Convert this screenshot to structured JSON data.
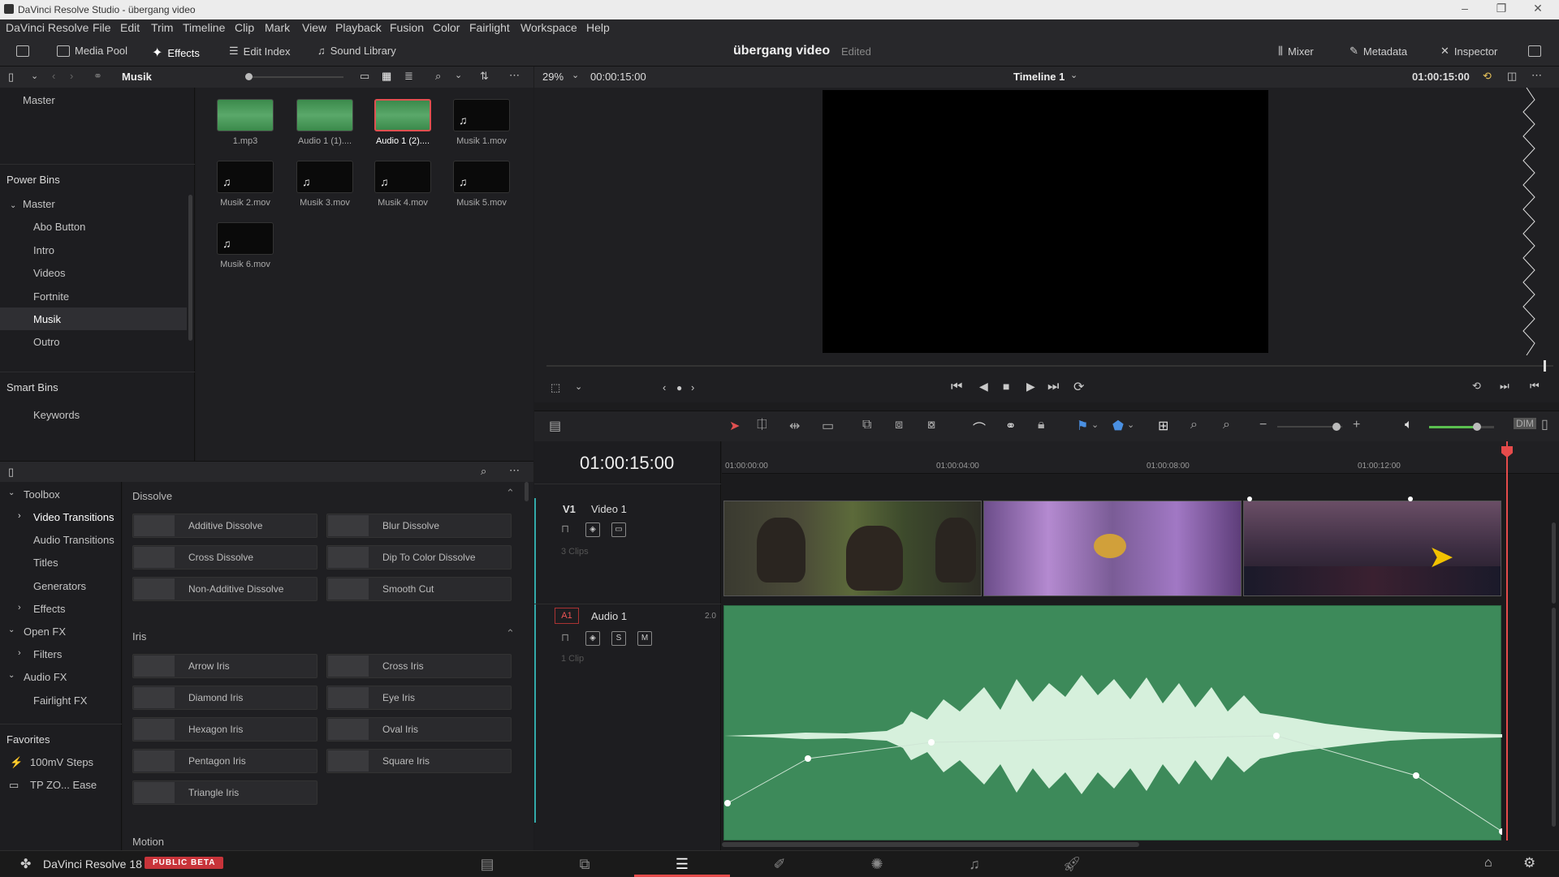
{
  "window": {
    "title": "DaVinci Resolve Studio - übergang video",
    "minimize": "–",
    "maximize": "❐",
    "close": "✕"
  },
  "menu": [
    "DaVinci Resolve",
    "File",
    "Edit",
    "Trim",
    "Timeline",
    "Clip",
    "Mark",
    "View",
    "Playback",
    "Fusion",
    "Color",
    "Fairlight",
    "Workspace",
    "Help"
  ],
  "toolbar": {
    "media_pool": "Media Pool",
    "effects": "Effects",
    "edit_index": "Edit Index",
    "sound_library": "Sound Library",
    "project_title": "übergang video",
    "project_status": "Edited",
    "mixer": "Mixer",
    "metadata": "Metadata",
    "inspector": "Inspector"
  },
  "media_pool": {
    "current_bin": "Musik",
    "master_label": "Master",
    "power_bins_header": "Power Bins",
    "power_bins": {
      "root": "Master",
      "children": [
        "Abo Button",
        "Intro",
        "Videos",
        "Fortnite",
        "Musik",
        "Outro"
      ],
      "selected": "Musik"
    },
    "smart_bins_header": "Smart Bins",
    "smart_bins": [
      "Keywords"
    ],
    "clips": [
      {
        "label": "1.mp3",
        "kind": "audio-wave"
      },
      {
        "label": "Audio 1 (1)....",
        "kind": "audio-wave"
      },
      {
        "label": "Audio 1 (2)....",
        "kind": "audio-wave-selected"
      },
      {
        "label": "Musik 1.mov",
        "kind": "music"
      },
      {
        "label": "Musik 2.mov",
        "kind": "music"
      },
      {
        "label": "Musik 3.mov",
        "kind": "music"
      },
      {
        "label": "Musik 4.mov",
        "kind": "music"
      },
      {
        "label": "Musik 5.mov",
        "kind": "music"
      },
      {
        "label": "Musik 6.mov",
        "kind": "music"
      }
    ]
  },
  "effects_library": {
    "tree": [
      {
        "label": "Toolbox",
        "expanded": true
      },
      {
        "label": "Video Transitions",
        "selected": true
      },
      {
        "label": "Audio Transitions"
      },
      {
        "label": "Titles"
      },
      {
        "label": "Generators"
      },
      {
        "label": "Effects"
      },
      {
        "label": "Open FX",
        "expanded": true
      },
      {
        "label": "Filters"
      },
      {
        "label": "Audio FX",
        "expanded": true
      },
      {
        "label": "Fairlight FX"
      }
    ],
    "favorites_header": "Favorites",
    "favorites": [
      "100mV Steps",
      "TP ZO... Ease"
    ],
    "dissolve_header": "Dissolve",
    "dissolve": [
      "Additive Dissolve",
      "Blur Dissolve",
      "Cross Dissolve",
      "Dip To Color Dissolve",
      "Non-Additive Dissolve",
      "Smooth Cut"
    ],
    "iris_header": "Iris",
    "iris": [
      "Arrow Iris",
      "Cross Iris",
      "Diamond Iris",
      "Eye Iris",
      "Hexagon Iris",
      "Oval Iris",
      "Pentagon Iris",
      "Square Iris",
      "Triangle Iris"
    ],
    "motion_header": "Motion"
  },
  "viewer": {
    "zoom": "29%",
    "source_timecode": "00:00:15:00",
    "timeline_name": "Timeline 1",
    "record_timecode": "01:00:15:00"
  },
  "timeline": {
    "current_timecode": "01:00:15:00",
    "ruler": [
      "01:00:00:00",
      "01:00:04:00",
      "01:00:08:00",
      "01:00:12:00"
    ],
    "video_track": {
      "id": "V1",
      "name": "Video 1",
      "clips_count": "3 Clips"
    },
    "audio_track": {
      "id": "A1",
      "name": "Audio 1",
      "channels": "2.0",
      "clips_count": "1 Clip",
      "solo": "S",
      "mute": "M"
    },
    "playhead_color": "#e64b4b",
    "audio_clip_color": "#3d8a5a"
  },
  "footer": {
    "app": "DaVinci Resolve 18",
    "badge": "PUBLIC BETA"
  }
}
